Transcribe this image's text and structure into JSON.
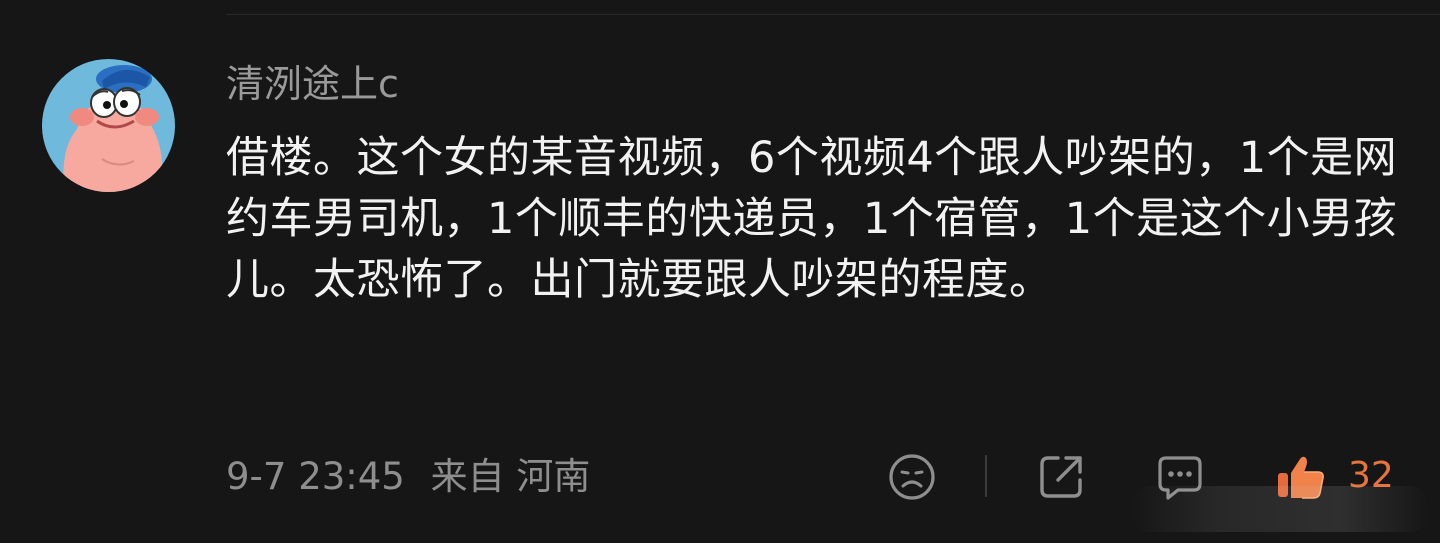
{
  "comment": {
    "username": "清洌途上c",
    "text": "借楼。这个女的某音视频，6个视频4个跟人吵架的，1个是网约车男司机，1个顺丰的快递员，1个宿管，1个是这个小男孩儿。太恐怖了。出门就要跟人吵架的程度。",
    "timestamp": "9-7 23:45",
    "location": "来自 河南",
    "like_count": "32"
  },
  "icons": {
    "avatar": "patrick-star-avatar",
    "dislike": "sad-face-icon",
    "share": "share-icon",
    "reply": "comment-icon",
    "like": "thumbs-up-icon"
  },
  "colors": {
    "background": "#161616",
    "text": "#f2f2f2",
    "muted": "#8e8e8e",
    "like_accent": "#e8743d"
  }
}
